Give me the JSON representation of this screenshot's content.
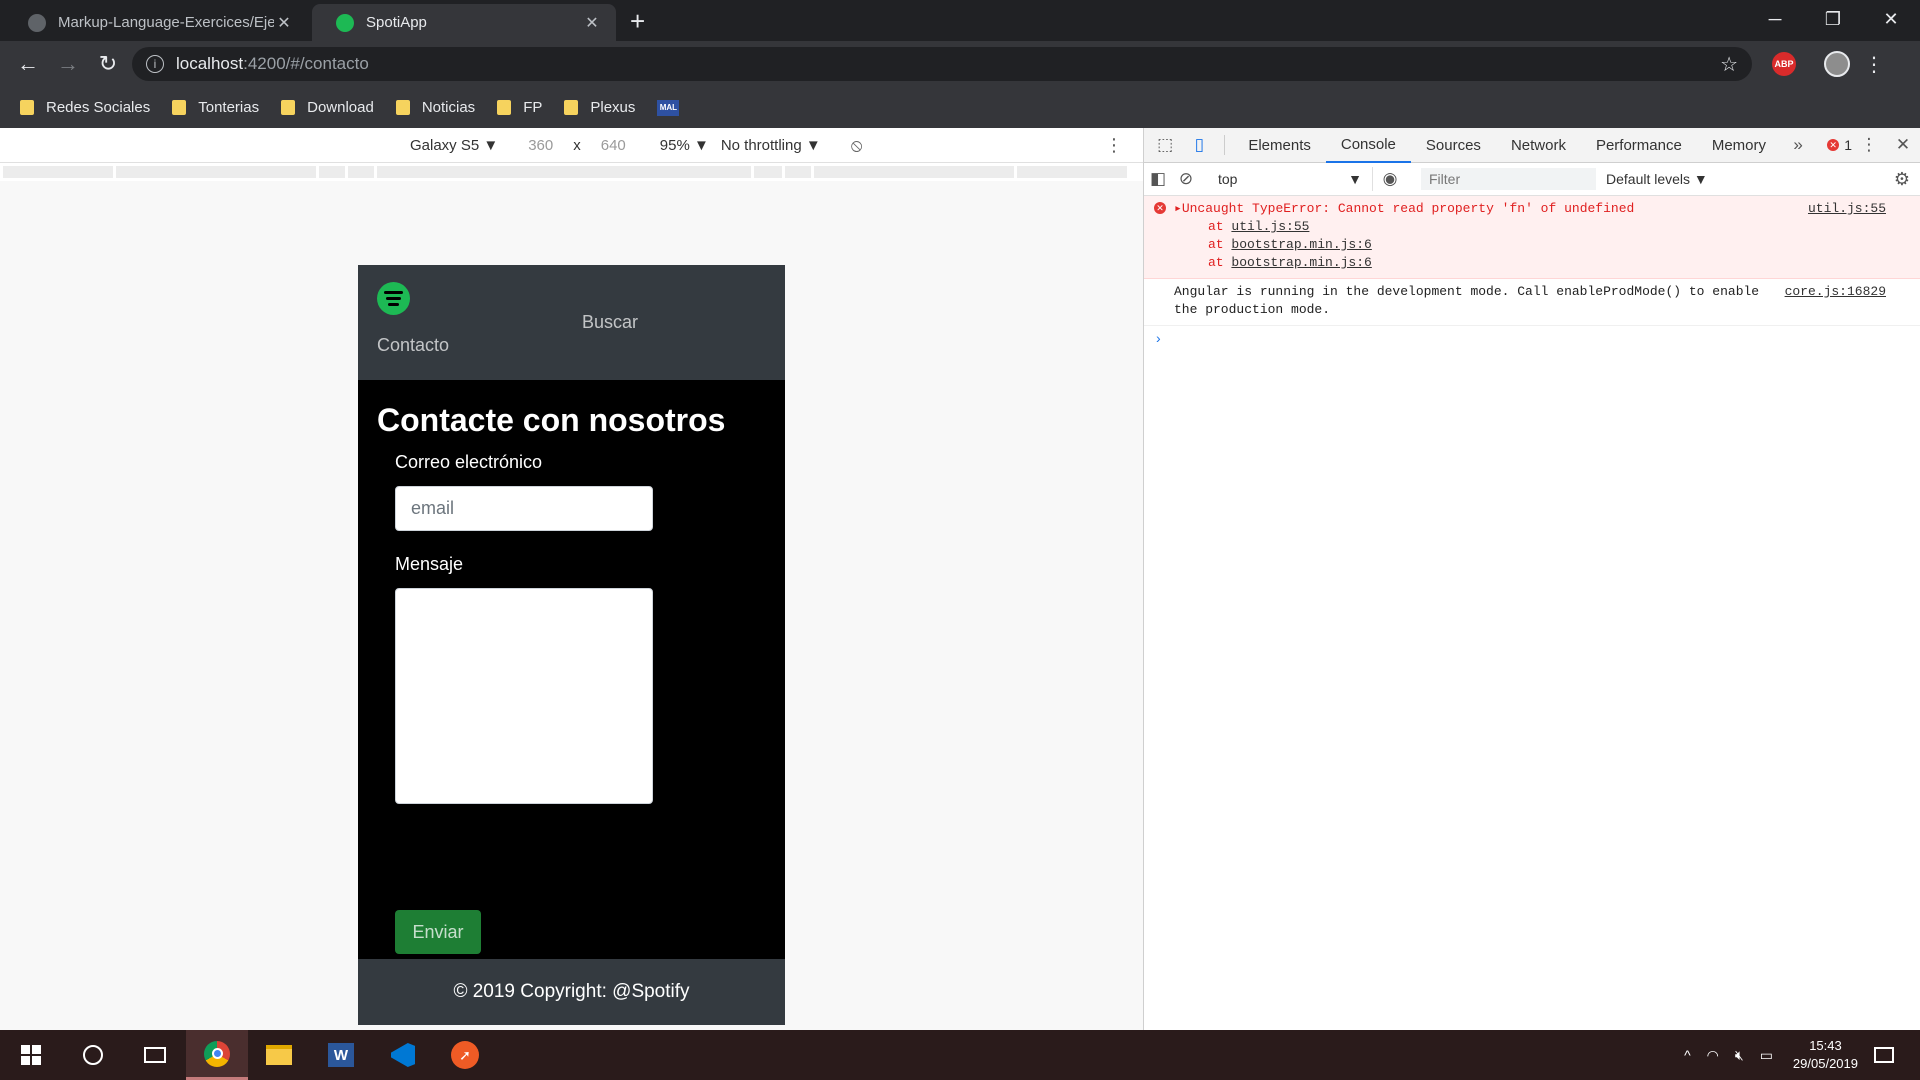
{
  "browser": {
    "tabs": [
      {
        "title": "Markup-Language-Exercices/Ejer",
        "close": "✕",
        "icon": "github-icon",
        "active": false
      },
      {
        "title": "SpotiApp",
        "close": "✕",
        "icon": "spotify-icon",
        "active": true
      }
    ],
    "new_tab": "+",
    "window_controls": {
      "minimize": "─",
      "maximize": "❐",
      "close": "✕"
    },
    "nav": {
      "back": "←",
      "forward": "→",
      "reload": "↻"
    },
    "url": {
      "host": "localhost",
      "path": ":4200/#/contacto"
    },
    "bookmark_star": "☆",
    "abp_label": "ABP",
    "menu": "⋮",
    "bookmarks": [
      "Redes Sociales",
      "Tonterias",
      "Download",
      "Noticias",
      "FP",
      "Plexus"
    ],
    "mal_label": "MAL"
  },
  "device_toolbar": {
    "device": "Galaxy S5 ▼",
    "width": "360",
    "times": "x",
    "height": "640",
    "zoom": "95% ▼",
    "throttling": "No throttling ▼",
    "more": "⋮"
  },
  "app": {
    "nav_contacto": "Contacto",
    "nav_buscar": "Buscar",
    "heading": "Contacte con nosotros",
    "email_label": "Correo electrónico",
    "email_placeholder": "email",
    "message_label": "Mensaje",
    "send_button": "Enviar",
    "footer": "© 2019 Copyright: @Spotify"
  },
  "devtools": {
    "tabs": [
      "Elements",
      "Console",
      "Sources",
      "Network",
      "Performance",
      "Memory"
    ],
    "active_tab": "Console",
    "more_tabs": "»",
    "error_count": "1",
    "context": "top",
    "context_arrow": "▼",
    "filter_placeholder": "Filter",
    "levels": "Default levels ▼",
    "settings": "⚙",
    "close": "✕",
    "menu": "⋮",
    "messages": [
      {
        "level": "error",
        "text": "▸Uncaught TypeError: Cannot read property 'fn' of undefined",
        "source": "util.js:55",
        "stack": [
          "util.js:55",
          "bootstrap.min.js:6",
          "bootstrap.min.js:6"
        ]
      },
      {
        "level": "info",
        "text": "Angular is running in the development mode. Call enableProdMode() to enable the production mode.",
        "source": "core.js:16829"
      }
    ],
    "prompt": "›"
  },
  "taskbar": {
    "apps": [
      "windows-start",
      "cortana",
      "task-view",
      "chrome",
      "file-explorer",
      "word",
      "vscode",
      "postman"
    ],
    "word_letter": "W",
    "time": "15:43",
    "date": "29/05/2019",
    "tray": {
      "chevron": "^",
      "wifi": "◠",
      "volume": "🔇︎",
      "battery": "▭"
    }
  },
  "colors": {
    "spotify_green": "#1db954",
    "navbar": "#343a40",
    "send_button": "#1e7e34",
    "error_red": "#e02020",
    "devtools_accent": "#1a73e8"
  }
}
